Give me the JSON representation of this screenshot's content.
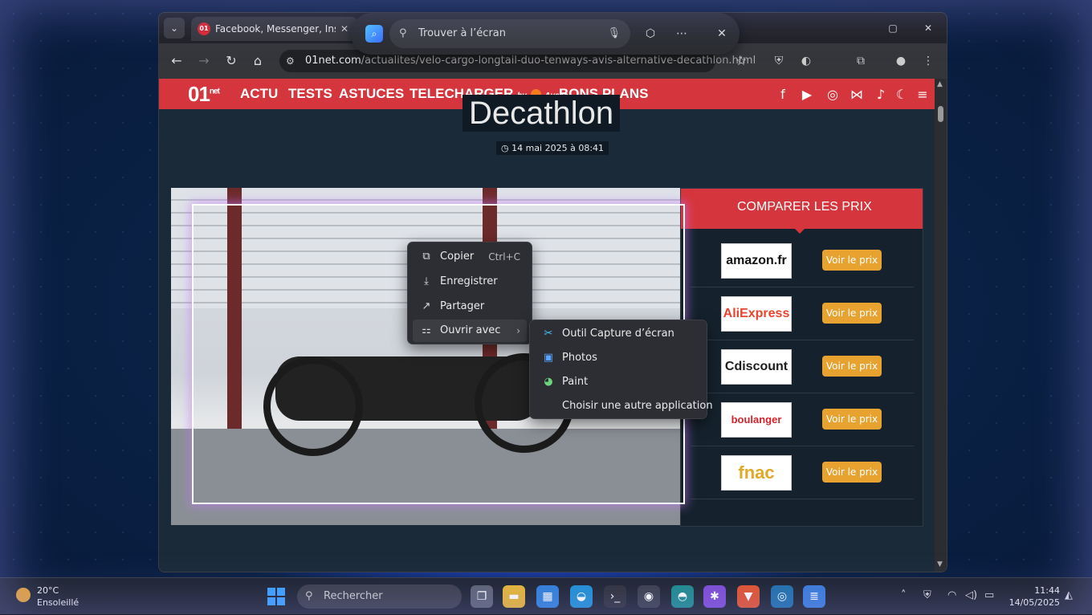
{
  "browser": {
    "tab_title": "Facebook, Messenger, Instagram",
    "tab_favicon": "01",
    "url_domain": "01net.com",
    "url_path": "/actualites/velo-cargo-longtail-duo-tenways-avis-alternative-decathlon.html"
  },
  "findbar": {
    "placeholder": "Trouver à l’écran"
  },
  "site": {
    "logo_main": "01",
    "logo_sup": "net",
    "nav": [
      "ACTU",
      "TESTS",
      "ASTUCES",
      "TELECHARGER",
      "BONS PLANS"
    ],
    "nav_by": "by",
    "nav_avast": "Avast",
    "headline_fragment": "Decathlon",
    "date": "14 mai 2025 à 08:41"
  },
  "compare": {
    "title": "COMPARER LES PRIX",
    "button_label": "Voir le prix",
    "stores": [
      {
        "name": "amazon.fr",
        "color": "#111111"
      },
      {
        "name": "AliExpress",
        "color": "#e8432c"
      },
      {
        "name": "Cdiscount",
        "color": "#1d1d1d"
      },
      {
        "name": "boulanger",
        "color": "#d2232a"
      },
      {
        "name": "fnac",
        "color": "#e1a925"
      }
    ]
  },
  "context_menu": {
    "items": [
      {
        "label": "Copier",
        "shortcut": "Ctrl+C",
        "icon": "copy-icon"
      },
      {
        "label": "Enregistrer",
        "shortcut": "",
        "icon": "download-icon"
      },
      {
        "label": "Partager",
        "shortcut": "",
        "icon": "share-icon"
      },
      {
        "label": "Ouvrir avec",
        "shortcut": "",
        "icon": "open-with-icon"
      }
    ],
    "submenu": [
      {
        "label": "Outil Capture d’écran",
        "icon": "snipping-tool-icon"
      },
      {
        "label": "Photos",
        "icon": "photos-icon"
      },
      {
        "label": "Paint",
        "icon": "paint-icon"
      },
      {
        "label": "Choisir une autre application",
        "icon": ""
      }
    ]
  },
  "taskbar": {
    "weather_temp": "20°C",
    "weather_desc": "Ensoleillé",
    "search_placeholder": "Rechercher",
    "time": "11:44",
    "date": "14/05/2025"
  },
  "colors": {
    "brand_red": "#d5353c",
    "button_gold": "#e7a230"
  }
}
